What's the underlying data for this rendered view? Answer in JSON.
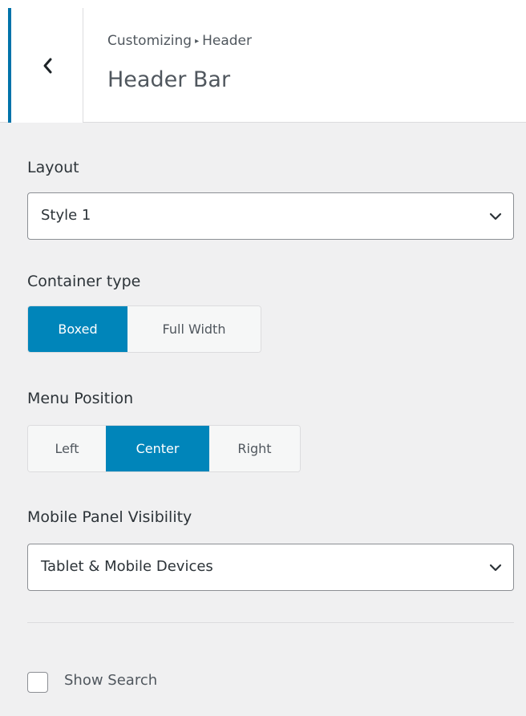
{
  "header": {
    "breadcrumb_root": "Customizing",
    "breadcrumb_sep": "▸",
    "breadcrumb_current": "Header",
    "title": "Header Bar",
    "back_icon": "chevron-left-icon"
  },
  "layout": {
    "label": "Layout",
    "value": "Style 1"
  },
  "container_type": {
    "label": "Container type",
    "options": [
      "Boxed",
      "Full Width"
    ],
    "selected": "Boxed"
  },
  "menu_position": {
    "label": "Menu Position",
    "options": [
      "Left",
      "Center",
      "Right"
    ],
    "selected": "Center"
  },
  "mobile_panel": {
    "label": "Mobile Panel Visibility",
    "value": "Tablet & Mobile Devices"
  },
  "show_search": {
    "label": "Show Search",
    "checked": false
  },
  "colors": {
    "accent": "#0085ba",
    "background": "#f0f0f1"
  }
}
